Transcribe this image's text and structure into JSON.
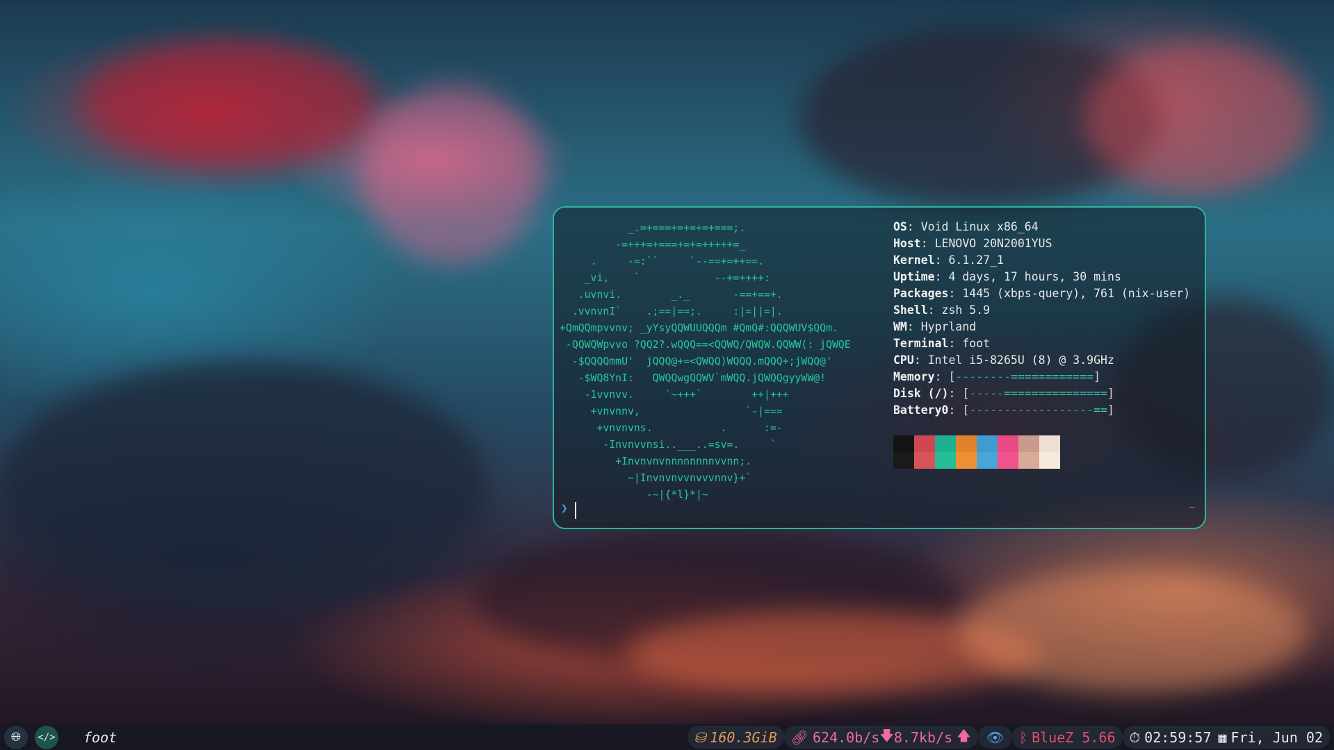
{
  "terminal": {
    "ascii_art": [
      "           _.=+===+=+=+=+===;.",
      "         -=+++=+===+=+=+++++=_",
      "     .     -=:``     `--==+=++==.",
      "    _vi,    `            --+=++++:",
      "   .uvnvi.        _._       -==+==+.",
      "  .vvnvnI`    .;==|==;.     :|=||=|.",
      "+QmQQmpvvnv; _yYsyQQWUUQQQm #QmQ#:QQQWUV$QQm.",
      " -QQWQWpvvo ?QQ2?.wQQQ==<QQWQ/QWQW.QQWW(: jQWQE",
      "  -$QQQQmmU'  jQQQ@+=<QWQQ)WQQQ.mQQQ+;jWQQ@'",
      "   -$WQ8YnI:   QWQQwgQQWV`mWQQ.jQWQQgyyWW@!",
      "    -1vvnvv.     `~+++`        ++|+++",
      "     +vnvnnv,                 `-|===",
      "      +vnvnvns.           .      :=-",
      "       -Invnvvnsi..___..=sv=.     `",
      "         +Invnvnvnnnnnnnnvvnn;.",
      "           ~|Invnvnvvnvvvnnv}+`",
      "              -~|{*l}*|~"
    ],
    "info": [
      {
        "key": "OS",
        "value": "Void Linux x86_64"
      },
      {
        "key": "Host",
        "value": "LENOVO 20N2001YUS"
      },
      {
        "key": "Kernel",
        "value": "6.1.27_1"
      },
      {
        "key": "Uptime",
        "value": "4 days, 17 hours, 30 mins"
      },
      {
        "key": "Packages",
        "value": "1445 (xbps-query), 761 (nix-user)"
      },
      {
        "key": "Shell",
        "value": "zsh 5.9"
      },
      {
        "key": "WM",
        "value": "Hyprland"
      },
      {
        "key": "Terminal",
        "value": "foot"
      },
      {
        "key": "CPU",
        "value": "Intel i5-8265U (8) @ 3.9GHz"
      }
    ],
    "bars": [
      {
        "key": "Memory",
        "empty": "--------",
        "fill": "============",
        "fraction": 0.6
      },
      {
        "key": "Disk (/)",
        "empty": "-----",
        "fill": "===============",
        "fraction": 0.75
      },
      {
        "key": "Battery0",
        "empty": "------------------",
        "fill": "==",
        "fraction": 0.1
      }
    ],
    "palette_top": [
      "#141414",
      "#d04651",
      "#1fb08f",
      "#e3822c",
      "#3f9bd0",
      "#ea4a86",
      "#c99b8c",
      "#ede0d2"
    ],
    "palette_bottom": [
      "#1a1a1a",
      "#d65457",
      "#24bf96",
      "#ef8f35",
      "#49a5d6",
      "#f0528e",
      "#d9a99a",
      "#f7e9da"
    ],
    "prompt_symbol": "❯",
    "right_symbol": "~"
  },
  "taskbar": {
    "window_title": "foot",
    "disk": "160.3GiB",
    "net_up": "624.0b/s",
    "net_down": "8.7kb/s",
    "bluetooth": "BlueZ 5.66",
    "time": "02:59:57",
    "date": "Fri, Jun 02"
  }
}
